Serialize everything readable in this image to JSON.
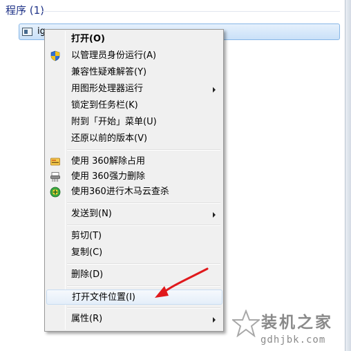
{
  "section": {
    "title": "程序 (1)"
  },
  "result": {
    "label": "ig..."
  },
  "menu": {
    "open": "打开(O)",
    "run_as_admin": "以管理员身份运行(A)",
    "troubleshoot": "兼容性疑难解答(Y)",
    "run_gpu": "用图形处理器运行",
    "pin_taskbar": "锁定到任务栏(K)",
    "pin_start": "附到「开始」菜单(U)",
    "restore_versions": "还原以前的版本(V)",
    "unlock_360": "使用 360解除占用",
    "delete_360": "使用 360强力删除",
    "scan_360": "使用360进行木马云查杀",
    "send_to": "发送到(N)",
    "cut": "剪切(T)",
    "copy": "复制(C)",
    "delete": "删除(D)",
    "open_location": "打开文件位置(I)",
    "properties": "属性(R)"
  },
  "icons": {
    "shield": "uac-shield-icon",
    "unlock": "360-unlock-icon",
    "shred": "360-shred-icon",
    "scan": "360-scan-icon"
  },
  "colors": {
    "header_text": "#1e3287",
    "selection_border": "#86b6e6",
    "annotation_arrow": "#e0191c",
    "watermark": "#8a8a8a"
  },
  "watermark": {
    "title": "装机之家",
    "url": "gdhjbk.com"
  }
}
